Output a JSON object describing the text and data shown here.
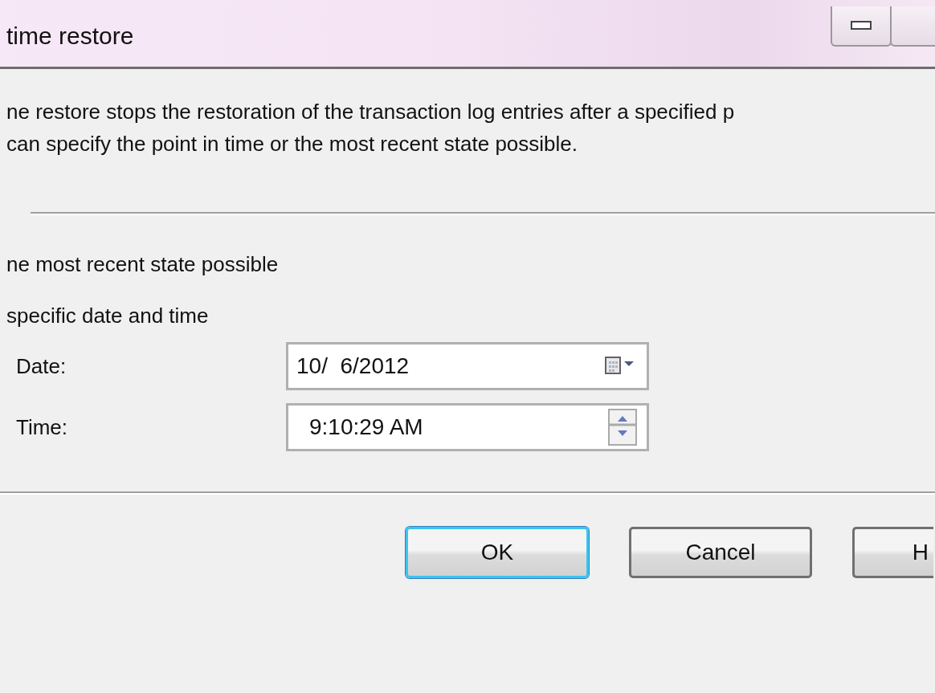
{
  "window": {
    "title": "time restore"
  },
  "description": [
    "ne restore stops the restoration of the transaction log entries after a specified p",
    "can specify the point in time or the most recent state possible."
  ],
  "options": [
    {
      "label": "ne most recent state possible"
    },
    {
      "label": "specific date and time"
    }
  ],
  "fields": [
    {
      "kind": "date",
      "label": "Date:",
      "value": "10/  6/2012"
    },
    {
      "kind": "time",
      "label": "Time:",
      "value": "9:10:29 AM"
    }
  ],
  "buttons": [
    {
      "label": "OK",
      "default": true
    },
    {
      "label": "Cancel",
      "default": false
    },
    {
      "label": "H",
      "default": false
    }
  ]
}
